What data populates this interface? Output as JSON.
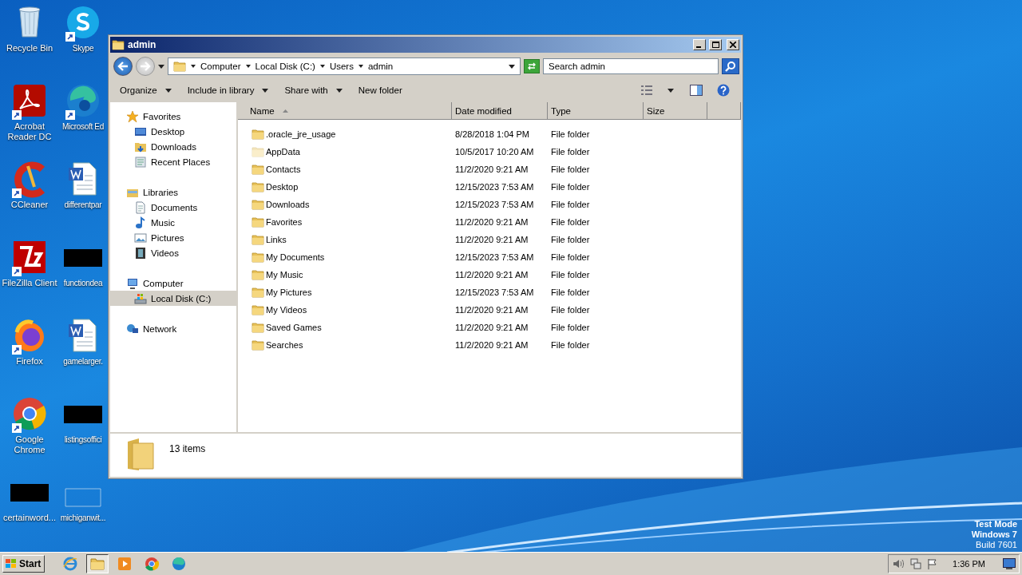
{
  "desktop": {
    "icons": [
      {
        "label": "Recycle Bin",
        "kind": "recycle",
        "shortcut": false
      },
      {
        "label": "Acrobat Reader DC",
        "kind": "acrobat",
        "shortcut": true
      },
      {
        "label": "CCleaner",
        "kind": "ccleaner",
        "shortcut": true
      },
      {
        "label": "FileZilla Client",
        "kind": "filezilla",
        "shortcut": true
      },
      {
        "label": "Firefox",
        "kind": "firefox",
        "shortcut": true
      },
      {
        "label": "Google Chrome",
        "kind": "chrome",
        "shortcut": true
      },
      {
        "label": "certainword...",
        "kind": "redacted",
        "shortcut": false
      },
      {
        "label": "Skype",
        "kind": "skype",
        "shortcut": true
      },
      {
        "label": "Microsoft Ed",
        "kind": "edge",
        "shortcut": true
      },
      {
        "label": "differentpar",
        "kind": "word",
        "shortcut": false
      },
      {
        "label": "functiondea",
        "kind": "redacted",
        "shortcut": false
      },
      {
        "label": "gamelarger.",
        "kind": "word",
        "shortcut": false
      },
      {
        "label": "listingsoffici",
        "kind": "redacted",
        "shortcut": false
      },
      {
        "label": "michiganwit...",
        "kind": "blank",
        "shortcut": false
      }
    ]
  },
  "window": {
    "title": "admin",
    "breadcrumb": [
      "Computer",
      "Local Disk (C:)",
      "Users",
      "admin"
    ],
    "search": {
      "placeholder": "Search admin"
    },
    "toolbar": [
      {
        "label": "Organize",
        "dropdown": true
      },
      {
        "label": "Include in library",
        "dropdown": true
      },
      {
        "label": "Share with",
        "dropdown": true
      },
      {
        "label": "New folder",
        "dropdown": false
      }
    ],
    "nav": [
      {
        "label": "Favorites",
        "kind": "star",
        "selected": false,
        "children": [
          {
            "label": "Desktop",
            "kind": "desktop",
            "selected": false
          },
          {
            "label": "Downloads",
            "kind": "downloads",
            "selected": false
          },
          {
            "label": "Recent Places",
            "kind": "recent",
            "selected": false
          }
        ]
      },
      {
        "label": "Libraries",
        "kind": "library",
        "selected": false,
        "children": [
          {
            "label": "Documents",
            "kind": "document",
            "selected": false
          },
          {
            "label": "Music",
            "kind": "music",
            "selected": false
          },
          {
            "label": "Pictures",
            "kind": "pictures",
            "selected": false
          },
          {
            "label": "Videos",
            "kind": "videos",
            "selected": false
          }
        ]
      },
      {
        "label": "Computer",
        "kind": "computer",
        "selected": false,
        "children": [
          {
            "label": "Local Disk (C:)",
            "kind": "disk",
            "selected": true
          }
        ]
      },
      {
        "label": "Network",
        "kind": "network",
        "selected": false
      }
    ],
    "columns": [
      "Name",
      "Date modified",
      "Type",
      "Size"
    ],
    "files": [
      {
        "name": ".oracle_jre_usage",
        "date": "8/28/2018 1:04 PM",
        "type": "File folder",
        "hidden": false
      },
      {
        "name": "AppData",
        "date": "10/5/2017 10:20 AM",
        "type": "File folder",
        "hidden": true
      },
      {
        "name": "Contacts",
        "date": "11/2/2020 9:21 AM",
        "type": "File folder",
        "hidden": false
      },
      {
        "name": "Desktop",
        "date": "12/15/2023 7:53 AM",
        "type": "File folder",
        "hidden": false
      },
      {
        "name": "Downloads",
        "date": "12/15/2023 7:53 AM",
        "type": "File folder",
        "hidden": false
      },
      {
        "name": "Favorites",
        "date": "11/2/2020 9:21 AM",
        "type": "File folder",
        "hidden": false
      },
      {
        "name": "Links",
        "date": "11/2/2020 9:21 AM",
        "type": "File folder",
        "hidden": false
      },
      {
        "name": "My Documents",
        "date": "12/15/2023 7:53 AM",
        "type": "File folder",
        "hidden": false
      },
      {
        "name": "My Music",
        "date": "11/2/2020 9:21 AM",
        "type": "File folder",
        "hidden": false
      },
      {
        "name": "My Pictures",
        "date": "12/15/2023 7:53 AM",
        "type": "File folder",
        "hidden": false
      },
      {
        "name": "My Videos",
        "date": "11/2/2020 9:21 AM",
        "type": "File folder",
        "hidden": false
      },
      {
        "name": "Saved Games",
        "date": "11/2/2020 9:21 AM",
        "type": "File folder",
        "hidden": false
      },
      {
        "name": "Searches",
        "date": "11/2/2020 9:21 AM",
        "type": "File folder",
        "hidden": false
      }
    ],
    "details": {
      "count": "13 items"
    }
  },
  "system_info": [
    "Test Mode",
    "Windows 7",
    "Build 7601"
  ],
  "taskbar": {
    "start": "Start",
    "apps": [
      {
        "kind": "ie",
        "selected": false
      },
      {
        "kind": "explorer",
        "selected": true
      },
      {
        "kind": "media",
        "selected": false
      },
      {
        "kind": "chrome",
        "selected": false
      },
      {
        "kind": "edge",
        "selected": false
      }
    ],
    "clock": "1:36 PM"
  }
}
